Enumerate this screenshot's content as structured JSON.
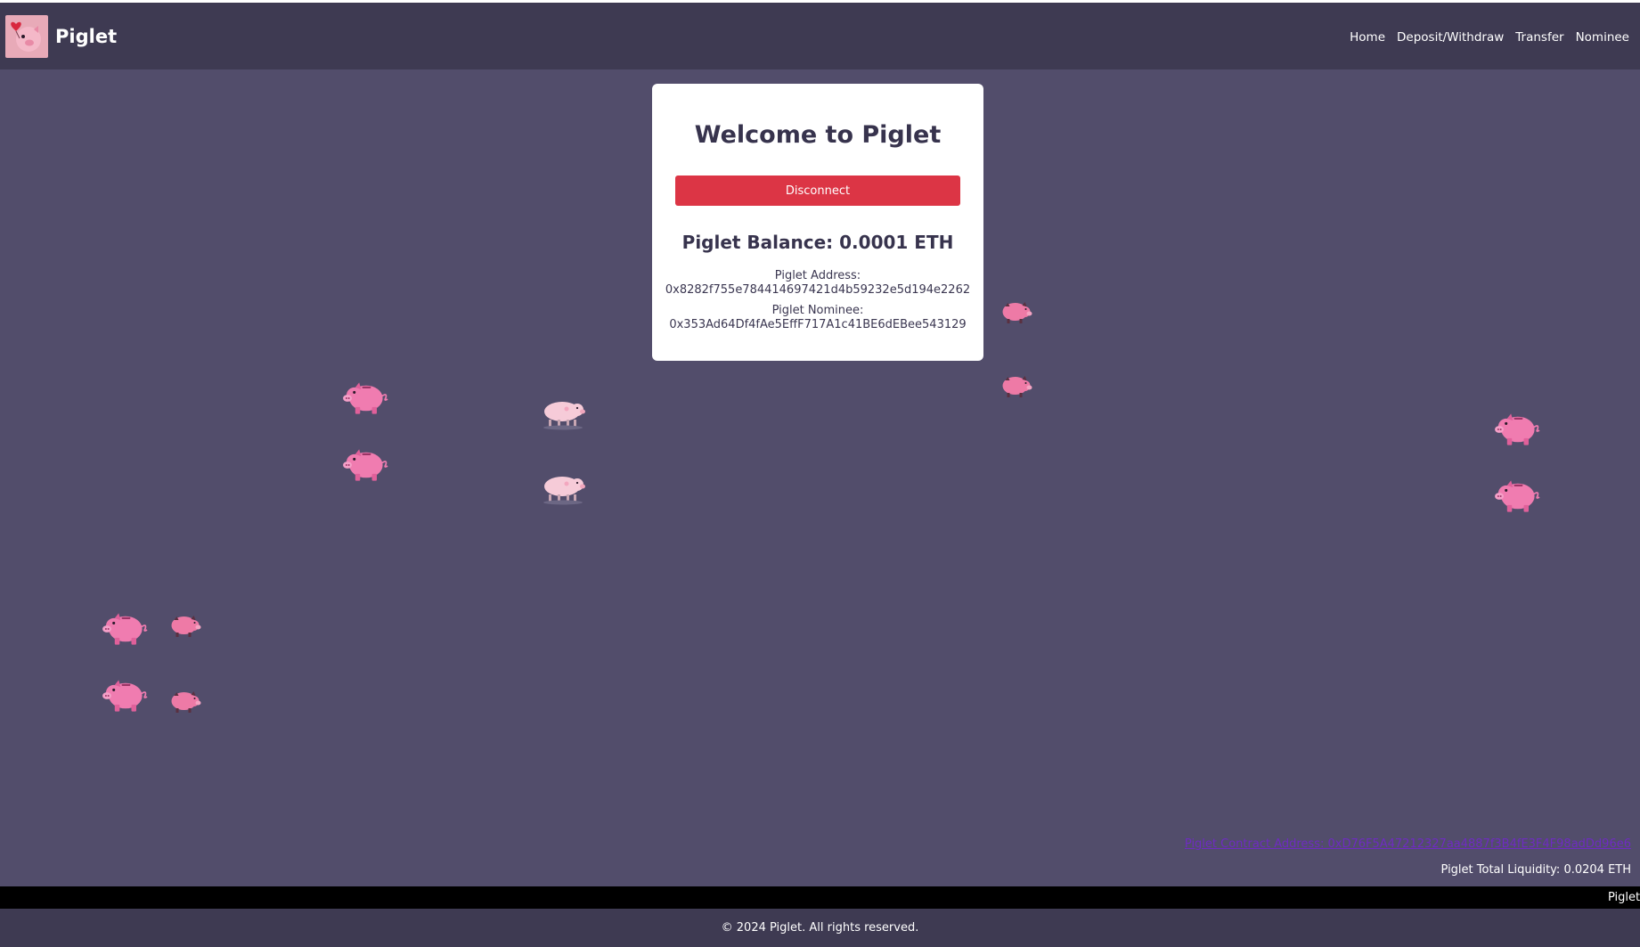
{
  "navbar": {
    "brand": "Piglet",
    "links": [
      "Home",
      "Deposit/Withdraw",
      "Transfer",
      "Nominee"
    ]
  },
  "card": {
    "title": "Welcome to Piglet",
    "disconnect_label": "Disconnect",
    "balance": "Piglet Balance: 0.0001 ETH",
    "address_label": "Piglet Address:",
    "address_value": "0x8282f755e784414697421d4b59232e5d194e2262",
    "nominee_label": "Piglet Nominee:",
    "nominee_value": "0x353Ad64Df4fAe5EffF717A1c41BE6dEBee543129"
  },
  "contract_address": "Piglet Contract Address: 0xD76F5A47212327aa4887f3B4fE3F4F98adDd96e6",
  "liquidity": "Piglet Total Liquidity: 0.0204 ETH",
  "ticker": "Piglet",
  "footer": "© 2024 Piglet. All rights reserved.",
  "colors": {
    "background": "#524d6b",
    "navbar": "#3e3a52",
    "danger": "#dc3545",
    "pig_pink": "#f07cb0",
    "pig_pale": "#f6cbd8",
    "link": "#6f2bc2"
  },
  "icons": {
    "logo": "piglet-logo-icon",
    "piggy_bank": "piggy-bank-icon",
    "pig_walking": "walking-pig-icon",
    "pig_running": "running-pig-icon"
  }
}
